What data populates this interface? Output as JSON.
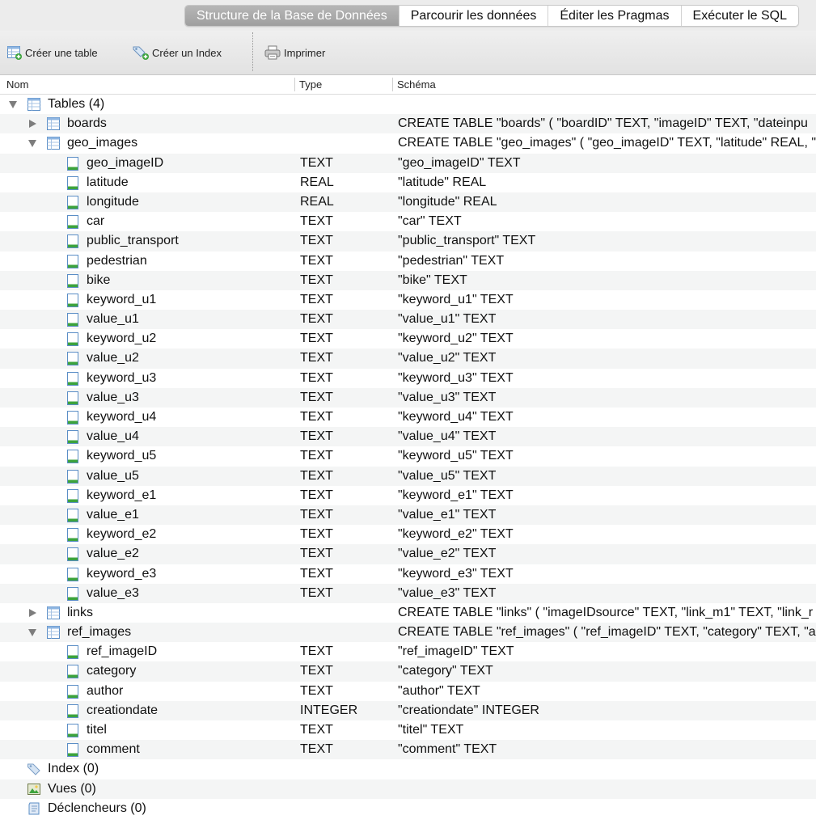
{
  "tabs": [
    {
      "label": "Structure de la Base de Données",
      "active": true
    },
    {
      "label": "Parcourir les données",
      "active": false
    },
    {
      "label": "Éditer les Pragmas",
      "active": false
    },
    {
      "label": "Exécuter le SQL",
      "active": false
    }
  ],
  "toolbar": {
    "create_table": "Créer une table",
    "create_index": "Créer un Index",
    "print": "Imprimer"
  },
  "columns": {
    "name": "Nom",
    "type": "Type",
    "schema": "Schéma"
  },
  "tree": {
    "tables_label": "Tables (4)",
    "tables": [
      {
        "name": "boards",
        "expanded": false,
        "schema": "CREATE TABLE \"boards\" ( \"boardID\" TEXT, \"imageID\" TEXT, \"dateinpu",
        "fields": []
      },
      {
        "name": "geo_images",
        "expanded": true,
        "schema": "CREATE TABLE \"geo_images\" ( \"geo_imageID\" TEXT, \"latitude\" REAL, \"",
        "fields": [
          {
            "name": "geo_imageID",
            "type": "TEXT",
            "schema": "\"geo_imageID\" TEXT"
          },
          {
            "name": "latitude",
            "type": "REAL",
            "schema": "\"latitude\" REAL"
          },
          {
            "name": "longitude",
            "type": "REAL",
            "schema": "\"longitude\" REAL"
          },
          {
            "name": "car",
            "type": "TEXT",
            "schema": "\"car\" TEXT"
          },
          {
            "name": "public_transport",
            "type": "TEXT",
            "schema": "\"public_transport\" TEXT"
          },
          {
            "name": "pedestrian",
            "type": "TEXT",
            "schema": "\"pedestrian\" TEXT"
          },
          {
            "name": "bike",
            "type": "TEXT",
            "schema": "\"bike\" TEXT"
          },
          {
            "name": "keyword_u1",
            "type": "TEXT",
            "schema": "\"keyword_u1\" TEXT"
          },
          {
            "name": "value_u1",
            "type": "TEXT",
            "schema": "\"value_u1\" TEXT"
          },
          {
            "name": "keyword_u2",
            "type": "TEXT",
            "schema": "\"keyword_u2\" TEXT"
          },
          {
            "name": "value_u2",
            "type": "TEXT",
            "schema": "\"value_u2\" TEXT"
          },
          {
            "name": "keyword_u3",
            "type": "TEXT",
            "schema": "\"keyword_u3\" TEXT"
          },
          {
            "name": "value_u3",
            "type": "TEXT",
            "schema": "\"value_u3\" TEXT"
          },
          {
            "name": "keyword_u4",
            "type": "TEXT",
            "schema": "\"keyword_u4\" TEXT"
          },
          {
            "name": "value_u4",
            "type": "TEXT",
            "schema": "\"value_u4\" TEXT"
          },
          {
            "name": "keyword_u5",
            "type": "TEXT",
            "schema": "\"keyword_u5\" TEXT"
          },
          {
            "name": "value_u5",
            "type": "TEXT",
            "schema": "\"value_u5\" TEXT"
          },
          {
            "name": "keyword_e1",
            "type": "TEXT",
            "schema": "\"keyword_e1\" TEXT"
          },
          {
            "name": "value_e1",
            "type": "TEXT",
            "schema": "\"value_e1\" TEXT"
          },
          {
            "name": "keyword_e2",
            "type": "TEXT",
            "schema": "\"keyword_e2\" TEXT"
          },
          {
            "name": "value_e2",
            "type": "TEXT",
            "schema": "\"value_e2\" TEXT"
          },
          {
            "name": "keyword_e3",
            "type": "TEXT",
            "schema": "\"keyword_e3\" TEXT"
          },
          {
            "name": "value_e3",
            "type": "TEXT",
            "schema": "\"value_e3\" TEXT"
          }
        ]
      },
      {
        "name": "links",
        "expanded": false,
        "schema": "CREATE TABLE \"links\" ( \"imageIDsource\" TEXT, \"link_m1\" TEXT, \"link_r",
        "fields": []
      },
      {
        "name": "ref_images",
        "expanded": true,
        "schema": "CREATE TABLE \"ref_images\" ( \"ref_imageID\" TEXT, \"category\" TEXT, \"a",
        "fields": [
          {
            "name": "ref_imageID",
            "type": "TEXT",
            "schema": "\"ref_imageID\" TEXT"
          },
          {
            "name": "category",
            "type": "TEXT",
            "schema": "\"category\" TEXT"
          },
          {
            "name": "author",
            "type": "TEXT",
            "schema": "\"author\" TEXT"
          },
          {
            "name": "creationdate",
            "type": "INTEGER",
            "schema": "\"creationdate\" INTEGER"
          },
          {
            "name": "titel",
            "type": "TEXT",
            "schema": "\"titel\" TEXT"
          },
          {
            "name": "comment",
            "type": "TEXT",
            "schema": "\"comment\" TEXT"
          }
        ]
      }
    ],
    "index_label": "Index (0)",
    "views_label": "Vues (0)",
    "triggers_label": "Déclencheurs (0)"
  },
  "colors": {
    "tab_active": "#a9a9a9",
    "row_alt": "#f4f5f5",
    "icon_blue": "#4a90d9",
    "icon_green": "#3ca33c"
  }
}
